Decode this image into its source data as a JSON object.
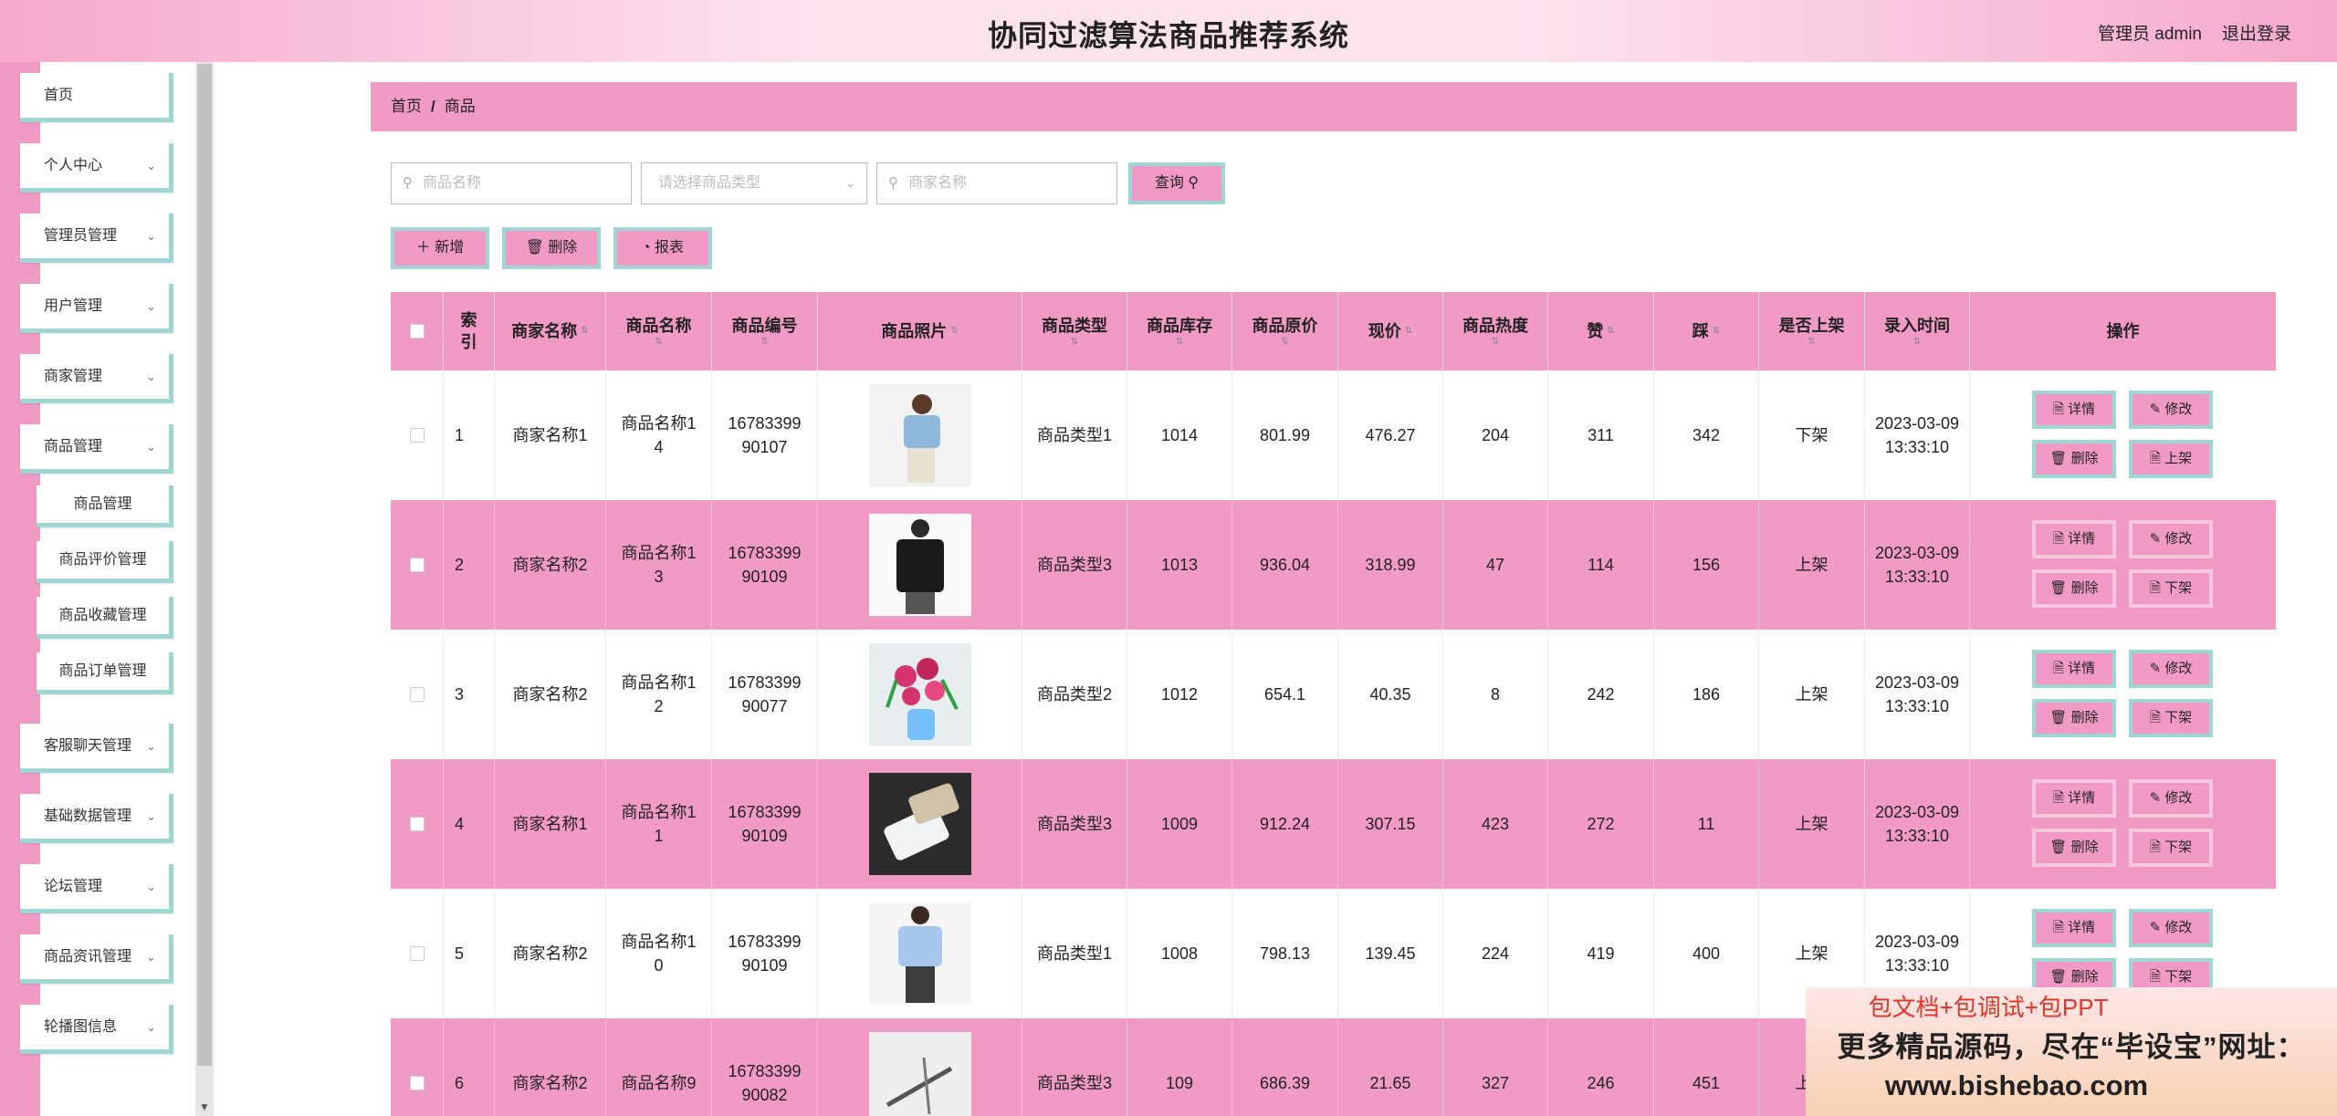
{
  "header": {
    "title": "协同过滤算法商品推荐系统",
    "user": "管理员 admin",
    "logout": "退出登录"
  },
  "sidebar": {
    "items": [
      {
        "label": "首页",
        "expandable": false
      },
      {
        "label": "个人中心",
        "expandable": true
      },
      {
        "label": "管理员管理",
        "expandable": true
      },
      {
        "label": "用户管理",
        "expandable": true
      },
      {
        "label": "商家管理",
        "expandable": true
      },
      {
        "label": "商品管理",
        "expandable": true
      },
      {
        "label": "客服聊天管理",
        "expandable": true
      },
      {
        "label": "基础数据管理",
        "expandable": true
      },
      {
        "label": "论坛管理",
        "expandable": true
      },
      {
        "label": "商品资讯管理",
        "expandable": true
      },
      {
        "label": "轮播图信息",
        "expandable": true
      }
    ],
    "sub_items": [
      "商品管理",
      "商品评价管理",
      "商品收藏管理",
      "商品订单管理"
    ]
  },
  "breadcrumb": {
    "home": "首页",
    "sep": "/",
    "current": "商品"
  },
  "search": {
    "name_placeholder": "商品名称",
    "type_placeholder": "请选择商品类型",
    "merchant_placeholder": "商家名称",
    "query": "查询"
  },
  "actions": {
    "add": "新增",
    "delete": "删除",
    "report": "报表"
  },
  "table": {
    "headers": [
      "索引",
      "商家名称",
      "商品名称",
      "商品编号",
      "商品照片",
      "商品类型",
      "商品库存",
      "商品原价",
      "现价",
      "商品热度",
      "赞",
      "踩",
      "是否上架",
      "录入时间",
      "操作"
    ],
    "ops": {
      "detail": "详情",
      "edit": "修改",
      "delete": "删除",
      "shelf_up": "上架",
      "shelf_down": "下架"
    },
    "rows": [
      {
        "index": "1",
        "merchant": "商家名称1",
        "name": "商品名称14",
        "code": "1678339990107",
        "type": "商品类型1",
        "stock": "1014",
        "price": "801.99",
        "now": "476.27",
        "heat": "204",
        "like": "311",
        "dislike": "342",
        "shelf": "下架",
        "time": "2023-03-09 13:33:10",
        "toggle": "上架",
        "photo": "blue-shirt-woman"
      },
      {
        "index": "2",
        "merchant": "商家名称2",
        "name": "商品名称13",
        "code": "1678339990109",
        "type": "商品类型3",
        "stock": "1013",
        "price": "936.04",
        "now": "318.99",
        "heat": "47",
        "like": "114",
        "dislike": "156",
        "shelf": "上架",
        "time": "2023-03-09 13:33:10",
        "toggle": "下架",
        "photo": "black-jacket-man"
      },
      {
        "index": "3",
        "merchant": "商家名称2",
        "name": "商品名称12",
        "code": "1678339990077",
        "type": "商品类型2",
        "stock": "1012",
        "price": "654.1",
        "now": "40.35",
        "heat": "8",
        "like": "242",
        "dislike": "186",
        "shelf": "上架",
        "time": "2023-03-09 13:33:10",
        "toggle": "下架",
        "photo": "flower-bouquet"
      },
      {
        "index": "4",
        "merchant": "商家名称1",
        "name": "商品名称11",
        "code": "1678339990109",
        "type": "商品类型3",
        "stock": "1009",
        "price": "912.24",
        "now": "307.15",
        "heat": "423",
        "like": "272",
        "dislike": "11",
        "shelf": "上架",
        "time": "2023-03-09 13:33:10",
        "toggle": "下架",
        "photo": "phones"
      },
      {
        "index": "5",
        "merchant": "商家名称2",
        "name": "商品名称10",
        "code": "1678339990109",
        "type": "商品类型1",
        "stock": "1008",
        "price": "798.13",
        "now": "139.45",
        "heat": "224",
        "like": "419",
        "dislike": "400",
        "shelf": "上架",
        "time": "2023-03-09 13:33:10",
        "toggle": "下架",
        "photo": "blue-shirt-man"
      },
      {
        "index": "6",
        "merchant": "商家名称2",
        "name": "商品名称9",
        "code": "1678339990082",
        "type": "商品类型3",
        "stock": "109",
        "price": "686.39",
        "now": "21.65",
        "heat": "327",
        "like": "246",
        "dislike": "451",
        "shelf": "上架",
        "time": "",
        "toggle": "",
        "photo": "tool"
      }
    ]
  },
  "banner": {
    "line1": "包文档+包调试+包PPT",
    "line2": "更多精品源码，尽在“毕设宝”网址：",
    "line3": "www.bishebao.com"
  }
}
